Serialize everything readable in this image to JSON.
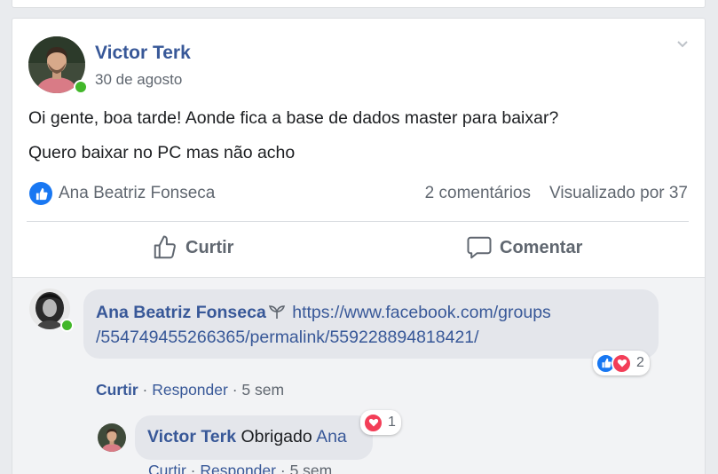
{
  "post": {
    "author": "Victor Terk",
    "date": "30 de agosto",
    "text_line1": "Oi gente, boa tarde! Aonde fica a base de dados master para baixar?",
    "text_line2": "Quero baixar no PC mas não acho",
    "likers": "Ana Beatriz Fonseca",
    "comments_count": "2 comentários",
    "views": "Visualizado por 37",
    "actions": {
      "like": "Curtir",
      "comment": "Comentar"
    }
  },
  "comments": [
    {
      "author": "Ana Beatriz Fonseca",
      "text_line1": "https://www.facebook.com/groups",
      "text_line2": "/554749455266365/permalink/559228894818421/",
      "reactions": {
        "icons": [
          "like",
          "love"
        ],
        "count": "2"
      },
      "meta": {
        "like": "Curtir",
        "reply": "Responder",
        "time": "5 sem",
        "sep": "·"
      }
    }
  ],
  "reply": {
    "author": "Victor Terk",
    "text": "Obrigado",
    "mention": "Ana",
    "reactions": {
      "icons": [
        "love"
      ],
      "count": "1"
    },
    "meta": {
      "like": "Curtir",
      "reply": "Responder",
      "time": "5 sem",
      "sep": "·"
    }
  },
  "colors": {
    "link": "#385898",
    "online": "#42b72a",
    "like": "#1877f2",
    "love": "#f33e58",
    "muted": "#606770"
  }
}
